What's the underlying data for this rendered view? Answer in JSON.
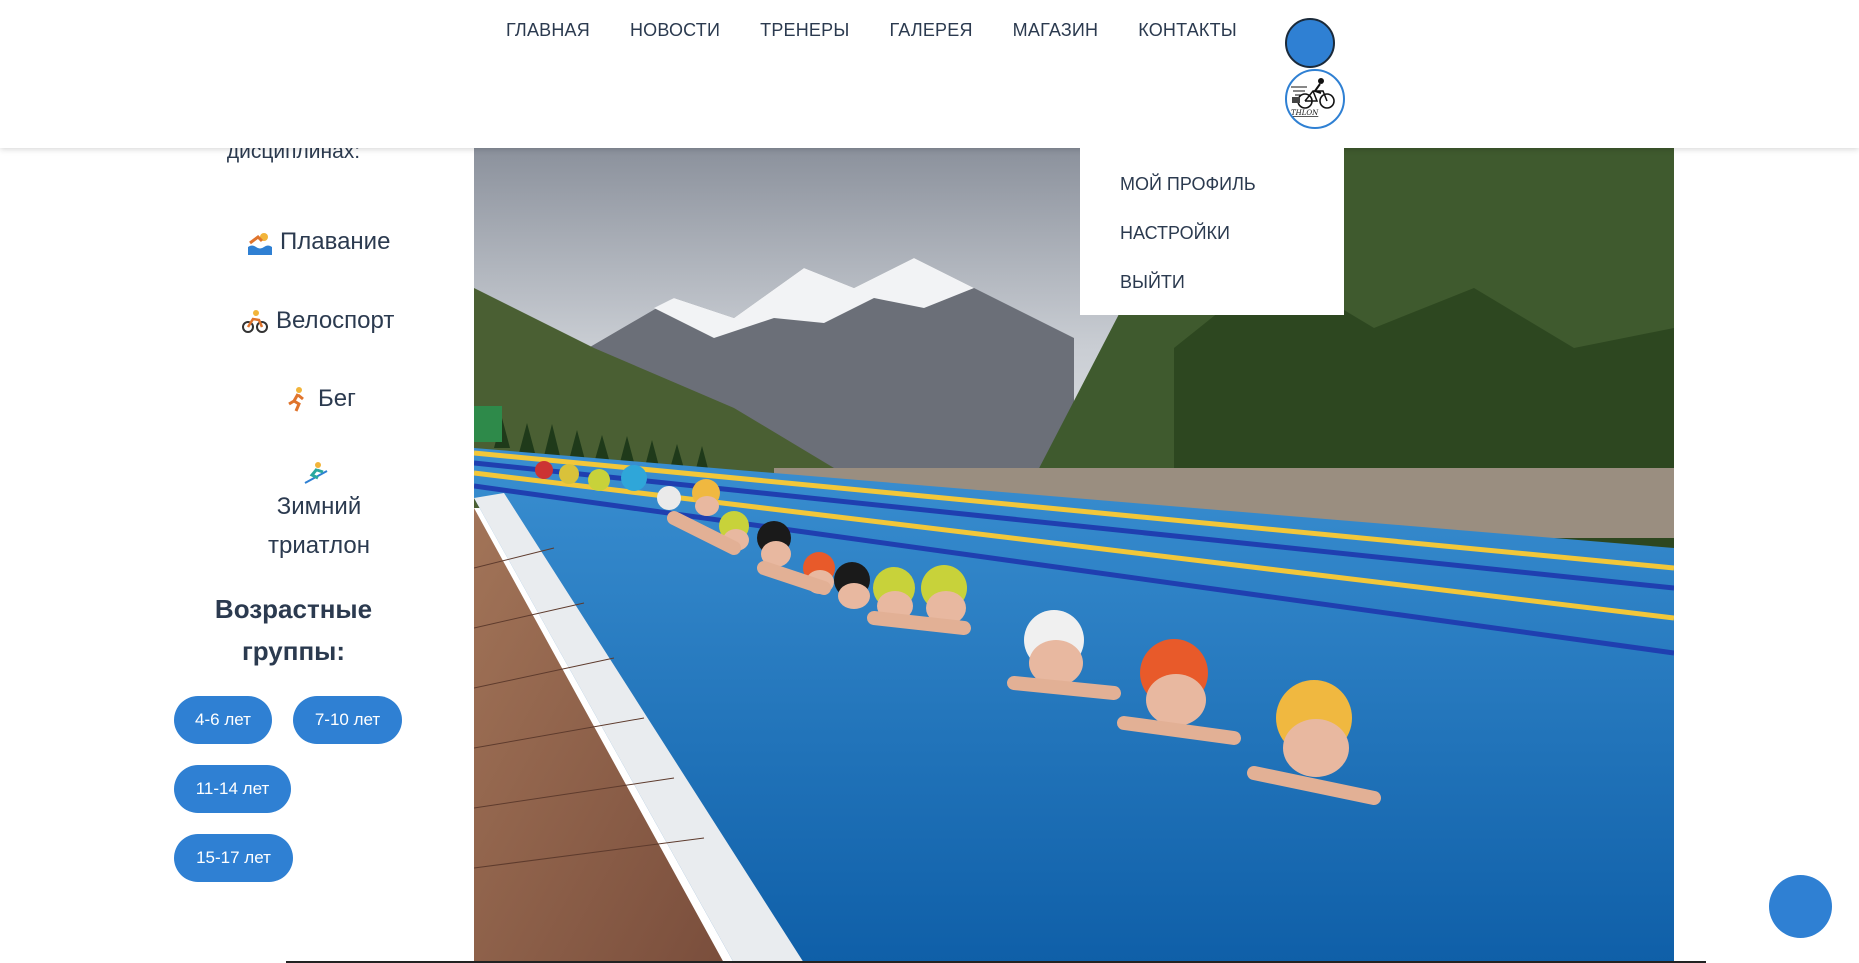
{
  "nav": {
    "items": [
      "ГЛАВНАЯ",
      "НОВОСТИ",
      "ТРЕНЕРЫ",
      "ГАЛЕРЕЯ",
      "МАГАЗИН",
      "КОНТАКТЫ"
    ]
  },
  "user_menu": {
    "items": [
      "МОЙ ПРОФИЛЬ",
      "НАСТРОЙКИ",
      "ВЫЙТИ"
    ]
  },
  "logo": {
    "text": "THLON"
  },
  "sidebar": {
    "disciplines_heading": "дисциплинах:",
    "disciplines": [
      {
        "icon": "swimmer-icon",
        "label": "Плавание"
      },
      {
        "icon": "cyclist-icon",
        "label": "Велоспорт"
      },
      {
        "icon": "runner-icon",
        "label": "Бег"
      },
      {
        "icon": "skier-icon",
        "label": "Зимний триатлон"
      }
    ],
    "age_heading": "Возрастные группы:",
    "age_groups": [
      "4-6 лет",
      "7-10 лет",
      "11-14 лет",
      "15-17 лет"
    ]
  },
  "colors": {
    "accent": "#2f80d3",
    "text": "#2b3a4f"
  }
}
